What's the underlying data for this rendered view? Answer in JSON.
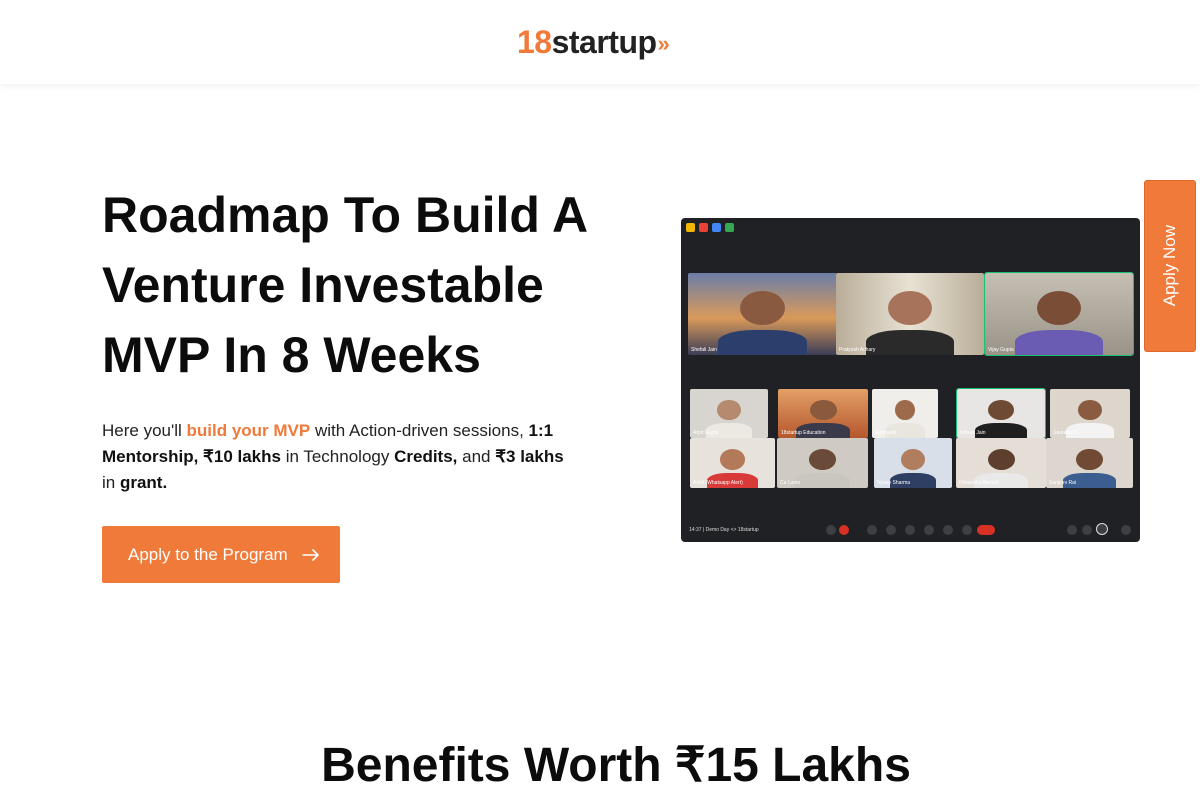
{
  "brand": {
    "logo_number": "18",
    "logo_word": "startup",
    "logo_arrows": "»",
    "accent_color": "#f07a3a"
  },
  "hero": {
    "title": "Roadmap To Build A Venture Investable MVP In 8 Weeks",
    "description": {
      "p1": "Here you'll ",
      "highlight": "build your MVP",
      "p2": " with Action-driven sessions, ",
      "b1": "1:1 Mentorship, ₹10 lakhs",
      "p3": " in Technology ",
      "b2": "Credits,",
      "p4": " and ",
      "b3": "₹3 lakhs",
      "p5": " in ",
      "b4": "grant."
    },
    "cta_label": "Apply to the Program"
  },
  "side_tab": {
    "label": "Apply Now"
  },
  "screenshot": {
    "meeting_time": "14:37",
    "meeting_title": "Demo Day <> 18startup",
    "participants": [
      "Shefali Jain",
      "Pratyush Achary",
      "Vijay Gupta",
      "Arpit Gupta",
      "18startup Education",
      "Siddharth",
      "Ishaan Jain",
      "Saurabh D",
      "Ankit (Whatsapp Alert)",
      "Ca Lumo",
      "Nyaay Sharma",
      "Himanshu Bansal",
      "Sanjeev Rai"
    ]
  },
  "benefits": {
    "title": "Benefits Worth ₹15 Lakhs"
  }
}
